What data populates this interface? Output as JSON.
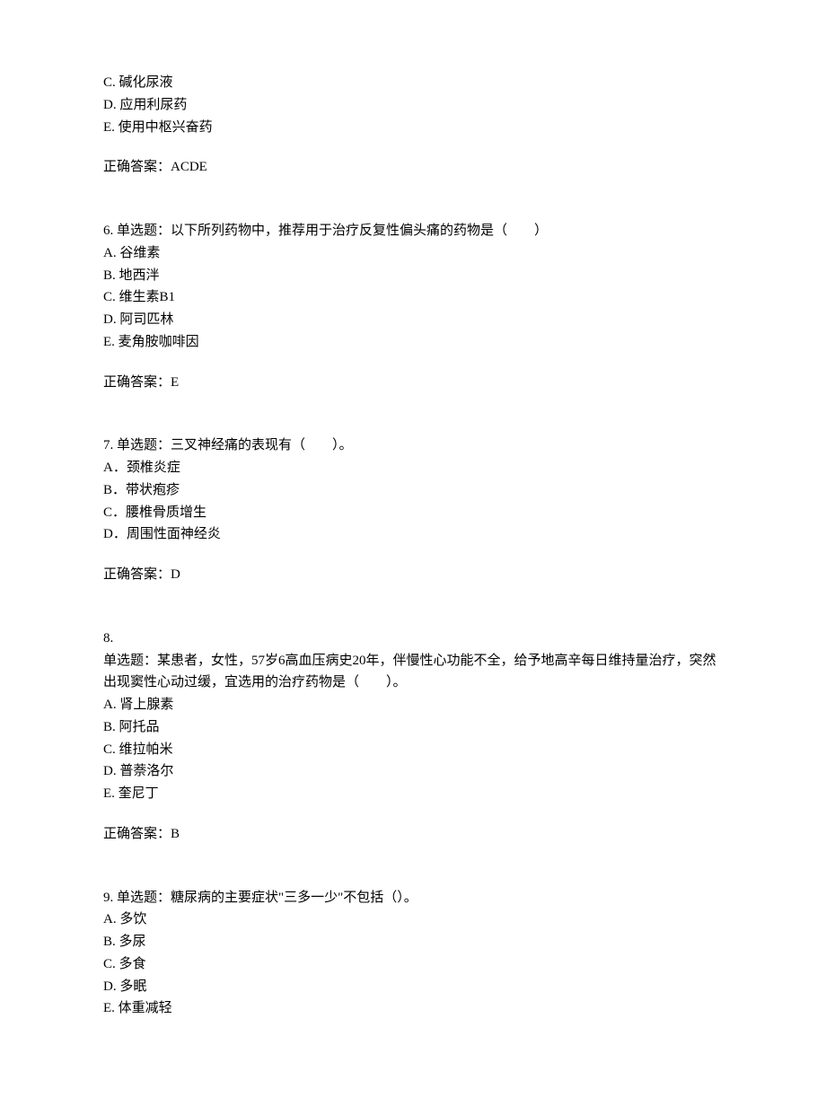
{
  "questions": [
    {
      "number": "",
      "stem": "",
      "options": [
        "C. 碱化尿液",
        "D. 应用利尿药",
        "E. 使用中枢兴奋药"
      ],
      "answer": "正确答案：ACDE"
    },
    {
      "number": "6.",
      "stem": " 单选题：以下所列药物中，推荐用于治疗反复性偏头痛的药物是（　　）",
      "options": [
        "A. 谷维素",
        "B. 地西泮",
        "C. 维生素B1",
        "D. 阿司匹林",
        "E. 麦角胺咖啡因"
      ],
      "answer": "正确答案：E"
    },
    {
      "number": "7.",
      "stem": " 单选题：三叉神经痛的表现有（　　）。",
      "options": [
        "A．颈椎炎症",
        "B．带状疱疹",
        "C．腰椎骨质增生",
        "D．周围性面神经炎"
      ],
      "answer": "正确答案：D"
    },
    {
      "number": "8.",
      "stem": "单选题：某患者，女性，57岁6高血压病史20年，伴慢性心功能不全，给予地高辛每日维持量治疗，突然出现窦性心动过缓，宜选用的治疗药物是（　　）。",
      "options": [
        "A. 肾上腺素",
        "B. 阿托品",
        "C. 维拉帕米",
        "D. 普萘洛尔",
        "E. 奎尼丁"
      ],
      "answer": "正确答案：B"
    },
    {
      "number": "9.",
      "stem": " 单选题：糖尿病的主要症状\"三多一少\"不包括（）。",
      "options": [
        "A. 多饮",
        "B. 多尿",
        "C. 多食",
        "D. 多眠",
        "E. 体重减轻"
      ],
      "answer": ""
    }
  ]
}
